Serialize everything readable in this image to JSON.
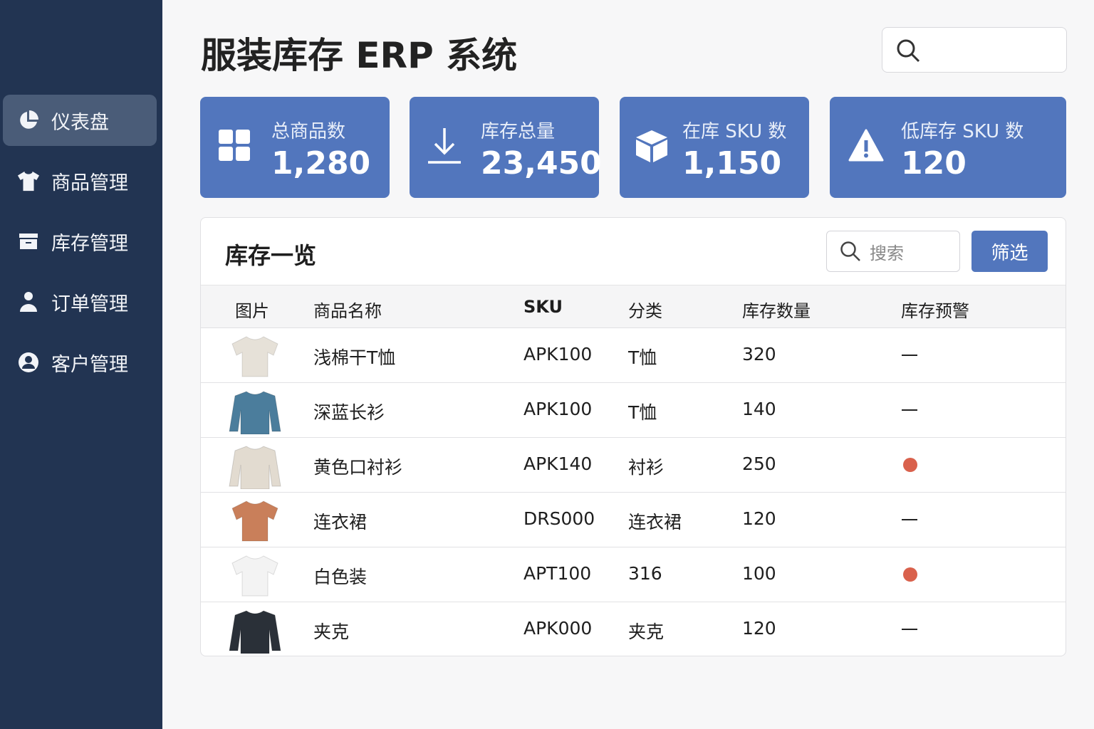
{
  "app": {
    "title": "服装库存 ERP 系统"
  },
  "sidebar": {
    "items": [
      {
        "label": "仪表盘",
        "icon": "pie-chart-icon",
        "active": true
      },
      {
        "label": "商品管理",
        "icon": "tshirt-icon"
      },
      {
        "label": "库存管理",
        "icon": "archive-box-icon"
      },
      {
        "label": "订单管理",
        "icon": "user-icon"
      },
      {
        "label": "客户管理",
        "icon": "user-circle-icon"
      }
    ]
  },
  "stats": [
    {
      "label": "总商品数",
      "value": "1,280",
      "icon": "grid-icon"
    },
    {
      "label": "库存总量",
      "value": "23,450",
      "icon": "download-icon"
    },
    {
      "label": "在库 SKU 数",
      "value": "1,150",
      "icon": "box-icon"
    },
    {
      "label": "低库存 SKU 数",
      "value": "120",
      "icon": "warning-icon"
    }
  ],
  "inventory": {
    "title": "库存一览",
    "search_placeholder": "搜索",
    "filter_label": "筛选",
    "columns": [
      "图片",
      "商品名称",
      "SKU",
      "分类",
      "库存数量",
      "库存预警"
    ],
    "rows": [
      {
        "name": "浅棉干T恤",
        "sku": "APK100",
        "category": "T恤",
        "qty": "320",
        "alert": false,
        "color": "#e6e1d8"
      },
      {
        "name": "深蓝长衫",
        "sku": "APK100",
        "category": "T恤",
        "qty": "140",
        "alert": false,
        "color": "#4b7d9c"
      },
      {
        "name": "黄色口衬衫",
        "sku": "APK140",
        "category": "衬衫",
        "qty": "250",
        "alert": true,
        "color": "#e2dbd0"
      },
      {
        "name": "连衣裙",
        "sku": "DRS000",
        "category": "连衣裙",
        "qty": "120",
        "alert": false,
        "color": "#c97f5a"
      },
      {
        "name": "白色装",
        "sku": "APT100",
        "category": "316",
        "qty": "100",
        "alert": true,
        "color": "#f3f3f3"
      },
      {
        "name": "夹克",
        "sku": "APK000",
        "category": "夹克",
        "qty": "120",
        "alert": false,
        "color": "#2a3038"
      }
    ]
  },
  "colors": {
    "sidebar": "#223452",
    "accent": "#5276bd",
    "alert": "#d9614c"
  }
}
